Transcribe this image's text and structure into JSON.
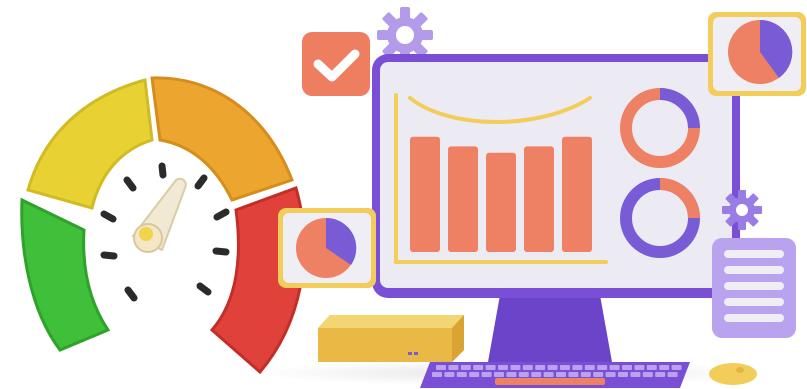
{
  "illustration": {
    "gauge_icon": "speedometer-gauge-icon",
    "checkbox_icon": "check-icon",
    "gear_icon": "gear-icon",
    "pie_icon": "pie-chart-icon",
    "document_icon": "document-list-icon",
    "monitor_icon": "desktop-monitor-icon",
    "keyboard_icon": "keyboard-icon",
    "mouse_icon": "mouse-icon",
    "cpu_box_icon": "computer-box-icon"
  },
  "colors": {
    "gauge_green": "#3fbf3a",
    "gauge_yellow": "#e8d233",
    "gauge_orange": "#eca52f",
    "gauge_red": "#e0413a",
    "purple": "#7a5bd6",
    "purple_light": "#b9a3ee",
    "coral": "#ee8163",
    "yellow": "#f3cd5a",
    "screen_bg": "#ecebf3",
    "check_box": "#ee7e5f"
  },
  "screen_chart": {
    "bar_values": [
      0.72,
      0.66,
      0.62,
      0.66,
      0.72
    ],
    "donut_coral_share": 0.75,
    "donut_purple_share": 0.72,
    "pie_purple_share": 0.42
  }
}
